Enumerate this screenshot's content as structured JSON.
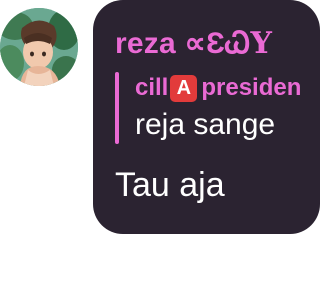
{
  "avatar": {
    "icon": "anime-profile-picture"
  },
  "message": {
    "sender_name": "reza ∝Ɛ",
    "sender_glyphs": "ᏇY",
    "reply": {
      "name_part1": "cill",
      "badge": "A",
      "name_part2": "presiden",
      "text": "reja sange"
    },
    "body": "Tau aja"
  },
  "colors": {
    "bubble": "#2b2331",
    "accent_pink": "#ea6ad4",
    "text": "#ffffff",
    "badge_red": "#e23b3b"
  }
}
